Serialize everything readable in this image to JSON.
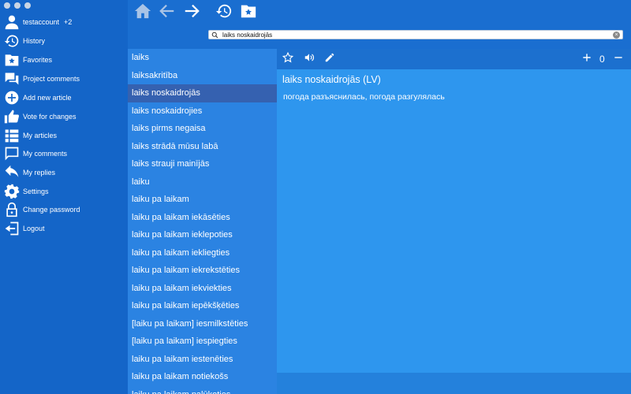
{
  "sidebar": {
    "account": {
      "name": "testaccount",
      "badge": "+2"
    },
    "items": [
      {
        "label": "History"
      },
      {
        "label": "Favorites"
      },
      {
        "label": "Project comments"
      },
      {
        "label": "Add new article"
      },
      {
        "label": "Vote for changes"
      },
      {
        "label": "My articles"
      },
      {
        "label": "My comments"
      },
      {
        "label": "My replies"
      },
      {
        "label": "Settings"
      },
      {
        "label": "Change password"
      },
      {
        "label": "Logout"
      }
    ]
  },
  "toolbar": {
    "icons": [
      "home-icon",
      "back-arrow-icon",
      "forward-arrow-icon",
      "history-icon",
      "favorites-folder-icon"
    ]
  },
  "search": {
    "value": "laiks noskaidrojās"
  },
  "wordlist": {
    "items": [
      "laiks",
      "laiksakritība",
      "laiks noskaidrojās",
      "laiks noskaidrojies",
      "laiks pirms negaisa",
      "laiks strādā mūsu labā",
      "laiks strauji mainījās",
      "laiku",
      "laiku pa laikam",
      "laiku pa laikam iekāsēties",
      "laiku pa laikam ieklepoties",
      "laiku pa laikam iekliegties",
      "laiku pa laikam iekrekstēties",
      "laiku pa laikam iekviekties",
      "laiku pa laikam iepēkšķēties",
      "[laiku pa laikam] iesmilkstēties",
      "[laiku pa laikam] iespiegties",
      "laiku pa laikam iestenēties",
      "laiku pa laikam notiekošs",
      "laiku pa laikam palūkoties"
    ],
    "selected_index": 2
  },
  "detail": {
    "counter": "0",
    "headword": "laiks noskaidrojās (LV)",
    "translation": "погода разъяснилась, погода разгулялась"
  },
  "colors": {
    "sidebar_bg": "#1465c8",
    "list_bg": "#2b83e2",
    "selected_bg": "#3561b0",
    "detail_bg": "#2e96ee"
  }
}
